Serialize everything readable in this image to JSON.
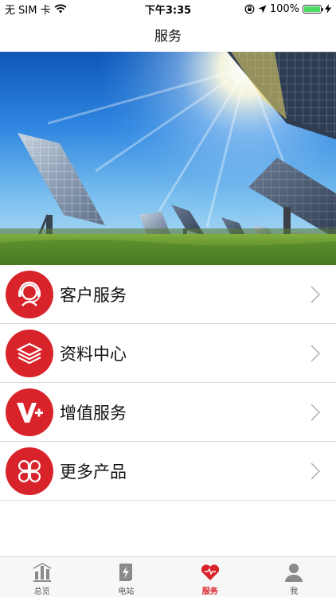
{
  "status_bar": {
    "carrier": "无 SIM 卡",
    "time": "下午3:35",
    "battery": "100%",
    "wifi_icon": "wifi-icon",
    "location_icon": "location-arrow-icon",
    "lock_icon": "orientation-lock-icon"
  },
  "nav": {
    "title": "服务"
  },
  "banner": {
    "image": "solar-panels-under-sun"
  },
  "menu": {
    "items": [
      {
        "label": "客户服务",
        "icon": "customer-service-icon"
      },
      {
        "label": "资料中心",
        "icon": "layers-icon"
      },
      {
        "label": "增值服务",
        "icon": "v-plus-icon"
      },
      {
        "label": "更多产品",
        "icon": "four-leaf-icon"
      }
    ]
  },
  "tabs": [
    {
      "label": "总览",
      "icon": "bar-chart-icon",
      "active": false
    },
    {
      "label": "电站",
      "icon": "power-station-icon",
      "active": false
    },
    {
      "label": "服务",
      "icon": "heart-icon",
      "active": true
    },
    {
      "label": "我",
      "icon": "person-icon",
      "active": false
    }
  ],
  "colors": {
    "accent": "#d9232b",
    "tab_inactive": "#8a8a8a"
  }
}
